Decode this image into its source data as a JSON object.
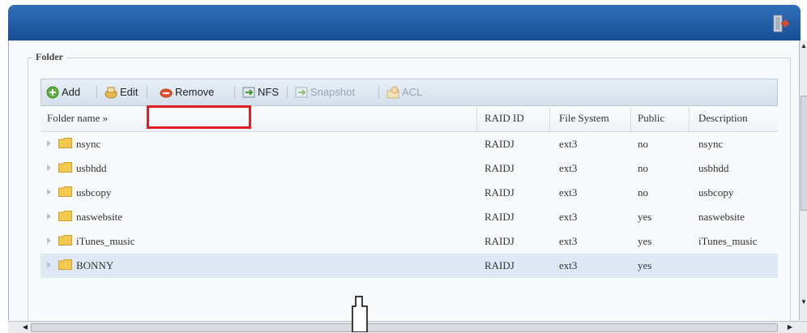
{
  "folder_panel": {
    "legend": "Folder",
    "toolbar": {
      "add": "Add",
      "edit": "Edit",
      "remove": "Remove",
      "nfs": "NFS",
      "snapshot": "Snapshot",
      "acl": "ACL"
    },
    "columns": {
      "name": "Folder name »",
      "raid_id": "RAID ID",
      "file_system": "File System",
      "public": "Public",
      "description": "Description"
    },
    "rows": [
      {
        "name": "nsync",
        "raid_id": "RAIDJ",
        "file_system": "ext3",
        "public": "no",
        "description": "nsync",
        "selected": false
      },
      {
        "name": "usbhdd",
        "raid_id": "RAIDJ",
        "file_system": "ext3",
        "public": "no",
        "description": "usbhdd",
        "selected": false
      },
      {
        "name": "usbcopy",
        "raid_id": "RAIDJ",
        "file_system": "ext3",
        "public": "no",
        "description": "usbcopy",
        "selected": false
      },
      {
        "name": "naswebsite",
        "raid_id": "RAIDJ",
        "file_system": "ext3",
        "public": "yes",
        "description": "naswebsite",
        "selected": false
      },
      {
        "name": "iTunes_music",
        "raid_id": "RAIDJ",
        "file_system": "ext3",
        "public": "yes",
        "description": "iTunes_music",
        "selected": false
      },
      {
        "name": "BONNY",
        "raid_id": "RAIDJ",
        "file_system": "ext3",
        "public": "yes",
        "description": "",
        "selected": true
      }
    ]
  },
  "colors": {
    "titlebar": "#1f5ea8",
    "highlight": "#e01c24",
    "selected_row": "#dde8f4",
    "folder": "#f2c94c"
  },
  "icons": {
    "exit": "exit-icon",
    "add": "add-icon",
    "edit": "edit-icon",
    "remove": "remove-icon",
    "nfs": "nfs-icon",
    "snapshot": "snapshot-icon",
    "acl": "acl-icon",
    "folder": "folder-icon",
    "expand": "expand-arrow-icon"
  }
}
